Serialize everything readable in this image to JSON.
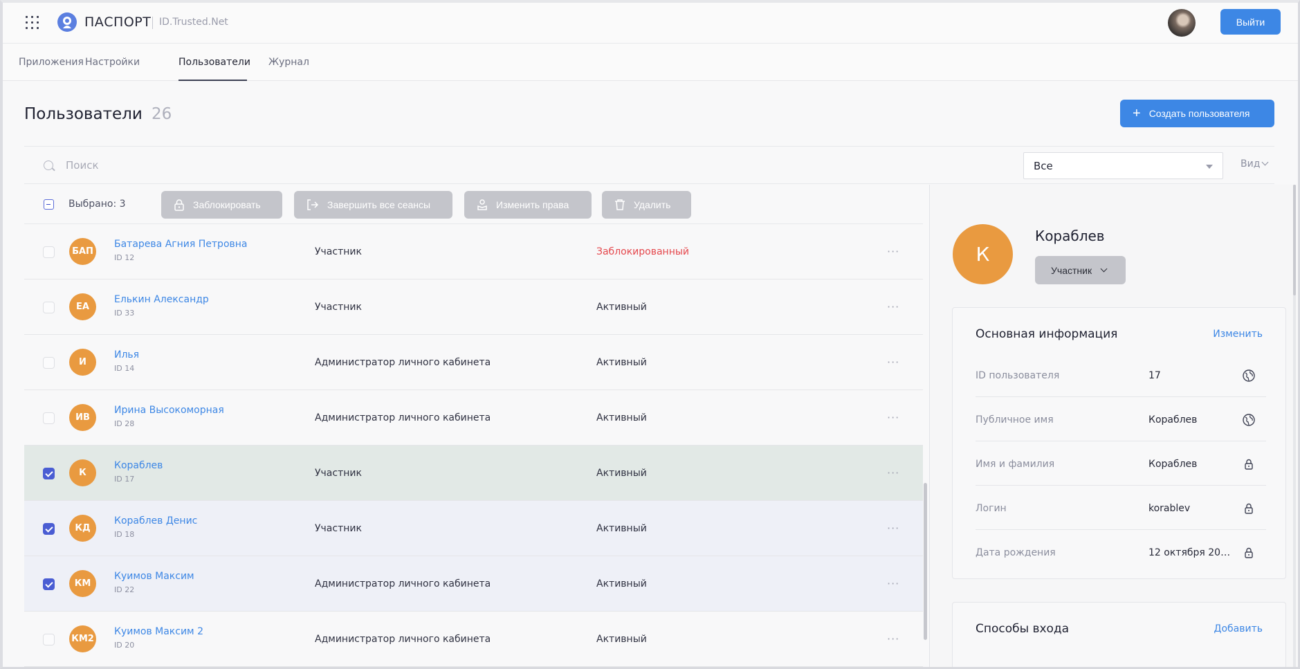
{
  "header": {
    "brand": "ПАСПОРТ",
    "subbrand": "ID.Trusted.Net",
    "logout_label": "Выйти"
  },
  "tabs": [
    {
      "label": "Приложения",
      "active": false
    },
    {
      "label": "Настройки",
      "active": false
    },
    {
      "label": "Пользователи",
      "active": true
    },
    {
      "label": "Журнал",
      "active": false
    }
  ],
  "page": {
    "title": "Пользователи",
    "count": "26",
    "create_label": "Создать пользователя"
  },
  "search": {
    "placeholder": "Поиск",
    "filter_value": "Все",
    "view_label": "Вид"
  },
  "actions": {
    "selected_label": "Выбрано: 3",
    "block_label": "Заблокировать",
    "end_sessions_label": "Завершить все сеансы",
    "change_rights_label": "Изменить права",
    "delete_label": "Удалить"
  },
  "users": [
    {
      "initials": "БАП",
      "name": "Батарева Агния Петровна",
      "id": "ID 12",
      "role": "Участник",
      "status": "Заблокированный",
      "blocked": true,
      "checked": false,
      "highlight": "none"
    },
    {
      "initials": "ЕА",
      "name": "Елькин Александр",
      "id": "ID 33",
      "role": "Участник",
      "status": "Активный",
      "blocked": false,
      "checked": false,
      "highlight": "none"
    },
    {
      "initials": "И",
      "name": "Илья",
      "id": "ID 14",
      "role": "Администратор личного кабинета",
      "status": "Активный",
      "blocked": false,
      "checked": false,
      "highlight": "none"
    },
    {
      "initials": "ИВ",
      "name": "Ирина Высокоморная",
      "id": "ID 28",
      "role": "Администратор личного кабинета",
      "status": "Активный",
      "blocked": false,
      "checked": false,
      "highlight": "none"
    },
    {
      "initials": "К",
      "name": "Кораблев",
      "id": "ID 17",
      "role": "Участник",
      "status": "Активный",
      "blocked": false,
      "checked": true,
      "highlight": "green"
    },
    {
      "initials": "КД",
      "name": "Кораблев Денис",
      "id": "ID 18",
      "role": "Участник",
      "status": "Активный",
      "blocked": false,
      "checked": true,
      "highlight": "blue"
    },
    {
      "initials": "КМ",
      "name": "Куимов Максим",
      "id": "ID 22",
      "role": "Администратор личного кабинета",
      "status": "Активный",
      "blocked": false,
      "checked": true,
      "highlight": "blue"
    },
    {
      "initials": "КМ2",
      "name": "Куимов Максим 2",
      "id": "ID 20",
      "role": "Администратор личного кабинета",
      "status": "Активный",
      "blocked": false,
      "checked": false,
      "highlight": "none"
    }
  ],
  "panel": {
    "initials": "К",
    "name": "Кораблев",
    "role": "Участник",
    "basic_title": "Основная информация",
    "edit_label": "Изменить",
    "fields": [
      {
        "label": "ID пользователя",
        "value": "17",
        "icon": "globe-icon"
      },
      {
        "label": "Публичное имя",
        "value": "Кораблев",
        "icon": "globe-icon"
      },
      {
        "label": "Имя и фамилия",
        "value": "Кораблев",
        "icon": "lock-icon"
      },
      {
        "label": "Логин",
        "value": "korablev",
        "icon": "lock-icon"
      },
      {
        "label": "Дата рождения",
        "value": "12 октября 200...",
        "icon": "lock-icon"
      }
    ],
    "login_methods_title": "Способы входа",
    "add_label": "Добавить"
  },
  "colors": {
    "accent": "#3d87e5",
    "avatar": "#e99a40",
    "danger": "#e5484d",
    "checkbox": "#4a5dd3"
  }
}
